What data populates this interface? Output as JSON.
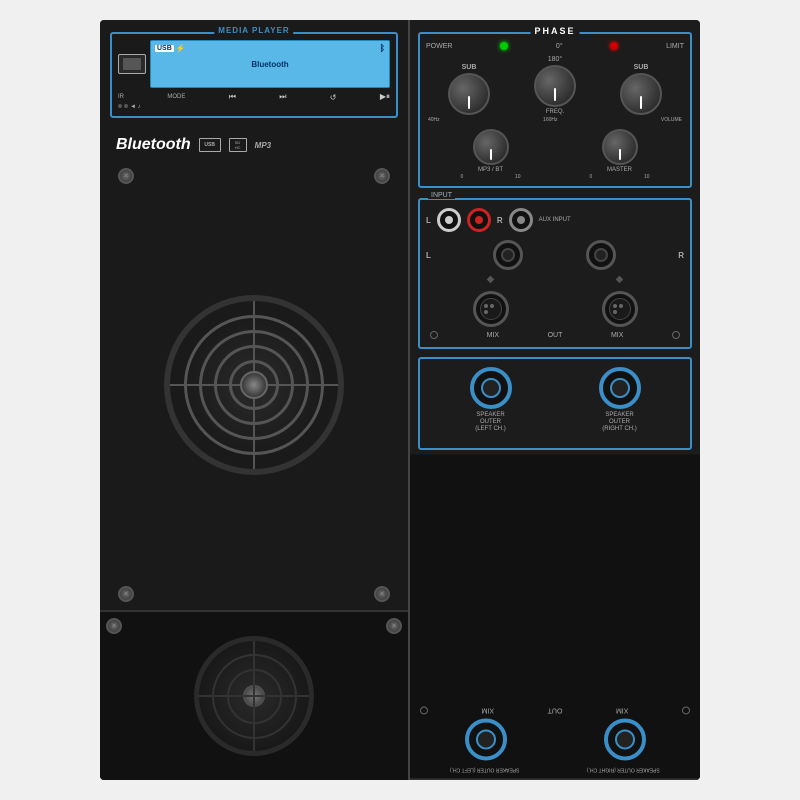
{
  "device": {
    "title": "MEDIA PLAYER",
    "phase_title": "PHASE",
    "bluetooth_text": "Bluetooth",
    "usb_label": "USB",
    "bt_symbol": "⚡",
    "display_text": "Bluetooth",
    "ir_label": "IR",
    "mode_label": "MODE",
    "input_label": "INPUT",
    "aux_label": "AUX INPUT",
    "mix_label": "MIX",
    "out_label": "OUT",
    "power_label": "POWER",
    "zero_deg": "0°",
    "one_eighty": "180°",
    "limit_label": "LIMIT",
    "sub_label": "SUB",
    "freq_label": "FREQ.",
    "hz40_label": "40Hz",
    "hz160_label": "160Hz",
    "vol_label": "VOLUME",
    "mp3_bt_label": "MP3 / BT",
    "master_label": "MASTER",
    "usb_icon": "USB",
    "sd_label": "SD HC",
    "mp3_label": "MP3",
    "speaker_out_l": "SPEAKER\nOUTER\n(LEFT CH.)",
    "speaker_out_r": "SPEAKER\nOUTER\n(RIGHT CH.)",
    "left_label": "L",
    "right_label": "R",
    "sub_left": "SUB",
    "sub_right": "SUB",
    "zero_l": "0",
    "ten_l": "10",
    "zero_r": "0",
    "ten_r": "10"
  }
}
